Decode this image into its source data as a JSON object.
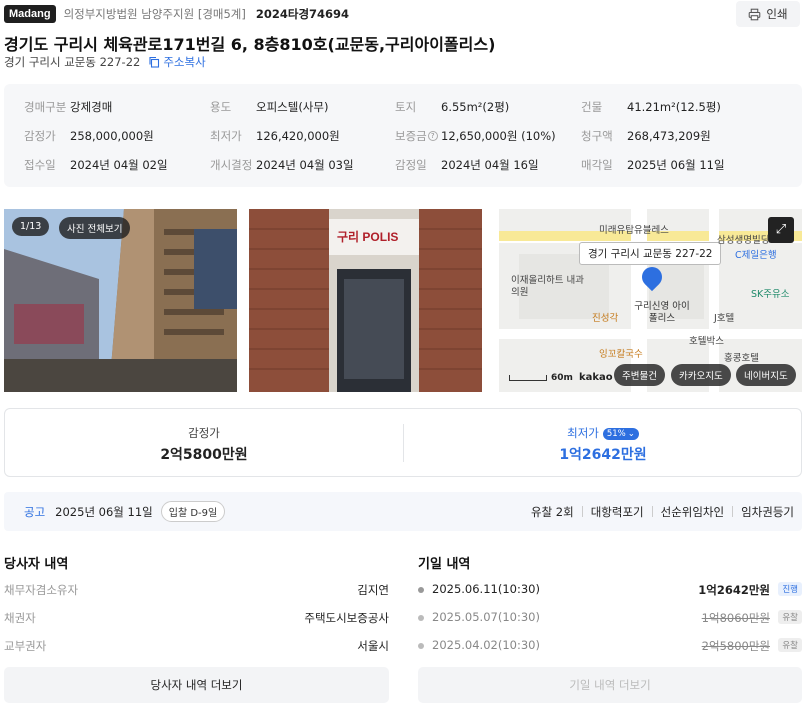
{
  "header": {
    "badge": "Madang",
    "court": "의정부지방법원 남양주지원 [경매5계]",
    "case_no": "2024타경74694",
    "print_label": "인쇄"
  },
  "title": "경기도 구리시 체육관로171번길 6, 8층810호(교문동,구리아이폴리스)",
  "address": {
    "lot": "경기 구리시 교문동 227-22",
    "copy_label": "주소복사"
  },
  "info": {
    "auction_type_label": "경매구분",
    "auction_type": "강제경매",
    "use_label": "용도",
    "use": "오피스텔(사무)",
    "land_label": "토지",
    "land": "6.55m²(2평)",
    "building_label": "건물",
    "building": "41.21m²(12.5평)",
    "appraisal_label": "감정가",
    "appraisal": "258,000,000원",
    "min_label": "최저가",
    "min": "126,420,000원",
    "deposit_label": "보증금",
    "deposit": "12,650,000원 (10%)",
    "claim_label": "청구액",
    "claim": "268,473,209원",
    "received_label": "접수일",
    "received": "2024년 04월 02일",
    "start_label": "개시결정",
    "start": "2024년 04월 03일",
    "appraised_label": "감정일",
    "appraised": "2024년 04월 16일",
    "sale_label": "매각일",
    "sale": "2025년 06월 11일"
  },
  "photos": {
    "counter": "1/13",
    "all_label": "사진 전체보기",
    "sign_text": "구리 POLIS"
  },
  "map": {
    "tooltip": "경기 구리시 교문동 227-22",
    "scale": "60m",
    "brand": "kakao",
    "buttons": [
      "주변물건",
      "카카오지도",
      "네이버지도"
    ],
    "labels": [
      "미래유탑유블레스",
      "삼성생명빌딩",
      "C제일은행",
      "이재올리하트 내과의원",
      "SK주유소",
      "구리신영 아이폴리스",
      "진성각",
      "J호텔",
      "호텔박스",
      "홍콩호텔",
      "잉꼬칼국수"
    ]
  },
  "prices": {
    "appraisal_label": "감정가",
    "appraisal": "2억5800만원",
    "min_label": "최저가",
    "min_pct": "51%",
    "min": "1억2642만원"
  },
  "notice": {
    "label": "공고",
    "date": "2025년 06월 11일",
    "dday": "입찰 D-9일",
    "links": [
      "유찰 2회",
      "대항력포기",
      "선순위임차인",
      "임차권등기"
    ]
  },
  "parties": {
    "title": "당사자 내역",
    "rows": [
      {
        "k": "채무자겸소유자",
        "v": "김지연"
      },
      {
        "k": "채권자",
        "v": "주택도시보증공사"
      },
      {
        "k": "교부권자",
        "v": "서울시"
      }
    ],
    "more": "당사자 내역 더보기"
  },
  "history": {
    "title": "기일 내역",
    "rows": [
      {
        "date": "2025.06.11(10:30)",
        "amount": "1억2642만원",
        "status": "진행"
      },
      {
        "date": "2025.05.07(10:30)",
        "amount": "1억8060만원",
        "status": "유찰"
      },
      {
        "date": "2025.04.02(10:30)",
        "amount": "2억5800만원",
        "status": "유찰"
      }
    ],
    "more": "기일 내역 더보기"
  },
  "colors": {
    "accent": "#2d6fe0",
    "badge_bg": "#1f1f1f",
    "panel_bg": "#f6f7f9"
  }
}
